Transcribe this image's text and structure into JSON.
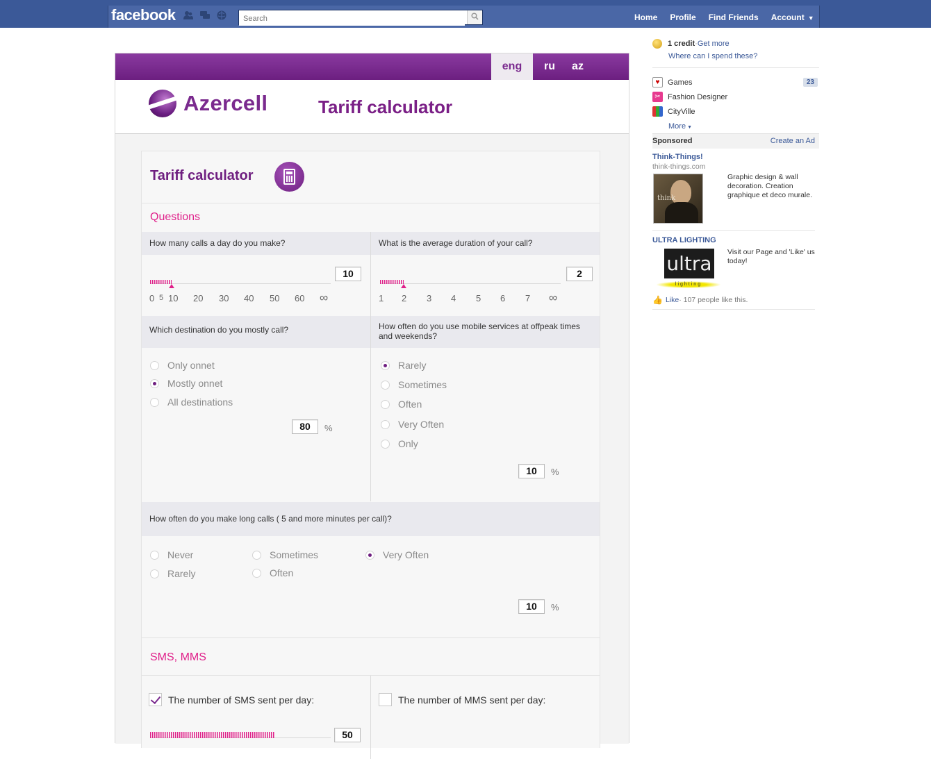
{
  "facebook": {
    "logo": "facebook",
    "search_placeholder": "Search",
    "nav": [
      "Home",
      "Profile",
      "Find Friends",
      "Account"
    ],
    "jewels": [
      "friend-requests-icon",
      "messages-icon",
      "notifications-icon"
    ]
  },
  "app": {
    "languages": [
      "eng",
      "ru",
      "az"
    ],
    "active_language": "eng",
    "brand": "Azercell",
    "header_title": "Tariff calculator",
    "panel_title": "Tariff calculator",
    "questions_title": "Questions",
    "q1": {
      "label": "How many calls a day do you make?",
      "value": "10",
      "ticks": [
        "0",
        "5",
        "10",
        "20",
        "30",
        "40",
        "50",
        "60",
        "∞"
      ],
      "fill_fraction": 0.12
    },
    "q2": {
      "label": "What is the average duration of your call?",
      "value": "2",
      "ticks": [
        "1",
        "2",
        "3",
        "4",
        "5",
        "6",
        "7",
        "∞"
      ],
      "fill_fraction": 0.13
    },
    "q3": {
      "label": "Which destination do you mostly call?",
      "options": [
        "Only onnet",
        "Mostly onnet",
        "All destinations"
      ],
      "selected": "Mostly onnet",
      "value": "80",
      "unit": "%"
    },
    "q4": {
      "label": "How often do you use mobile services at offpeak times and weekends?",
      "options": [
        "Rarely",
        "Sometimes",
        "Often",
        "Very Often",
        "Only"
      ],
      "selected": "Rarely",
      "value": "10",
      "unit": "%"
    },
    "q5": {
      "label": "How often do you make long calls ( 5 and more minutes per call)?",
      "options": [
        "Never",
        "Rarely",
        "Sometimes",
        "Often",
        "Very Often"
      ],
      "selected": "Very Often",
      "value": "10",
      "unit": "%"
    },
    "sms_title": "SMS, MMS",
    "sms": {
      "label": "The number of SMS sent per day:",
      "checked": true,
      "value": "50",
      "fill_fraction": 0.69
    },
    "mms": {
      "label": "The number of MMS sent per day:",
      "checked": false
    }
  },
  "sidebar": {
    "credits": {
      "amount": "1 credit",
      "separator": " · ",
      "get_more": "Get more",
      "spend": "Where can I spend these?"
    },
    "apps": [
      {
        "name": "Games",
        "badge": "23"
      },
      {
        "name": "Fashion Designer"
      },
      {
        "name": "CityVille"
      }
    ],
    "more": "More",
    "sponsored": "Sponsored",
    "create_ad": "Create an Ad",
    "ads": [
      {
        "title": "Think-Things!",
        "url": "think-things.com",
        "text": "Graphic design & wall decoration. Creation graphique et deco murale.",
        "image_text": "think"
      },
      {
        "title": "ULTRA LIGHTING",
        "text": "Visit our Page and 'Like' us today!",
        "image_text": "ultra",
        "image_subtext": "lighting",
        "like": "Like",
        "likes_text": " · 107 people like this."
      }
    ]
  },
  "colors": {
    "fb_blue": "#3b5998",
    "azercell_purple": "#7a2a8e",
    "accent_pink": "#e0208a"
  }
}
